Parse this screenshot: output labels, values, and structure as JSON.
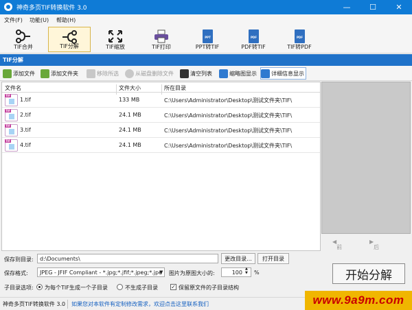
{
  "window": {
    "title": "神奇多页TIF转换软件 3.0",
    "controls": [
      "—",
      "☐",
      "✕"
    ]
  },
  "menu": [
    "文件(F)",
    "功能(U)",
    "帮助(H)"
  ],
  "toolbar": [
    "TIF合并",
    "TIF分解",
    "TIF缩放",
    "TIF打印",
    "PPT转TIF",
    "PDF转TIF",
    "TIF转PDF"
  ],
  "doc_badges": {
    "ppt": "PPT",
    "pdf": "PDF"
  },
  "section_title": "TIF分解",
  "actions": [
    "添加文件",
    "添加文件夹",
    "移除所选",
    "从磁盘删除文件",
    "清空列表",
    "缩略图显示",
    "详细信息显示"
  ],
  "columns": [
    "文件名",
    "文件大小",
    "所在目录"
  ],
  "files": [
    {
      "name": "1.tif",
      "size": "133 MB",
      "dir": "C:\\Users\\Administrator\\Desktop\\测试文件夹\\TIF\\"
    },
    {
      "name": "2.tif",
      "size": "24.1 MB",
      "dir": "C:\\Users\\Administrator\\Desktop\\测试文件夹\\TIF\\"
    },
    {
      "name": "3.tif",
      "size": "24.1 MB",
      "dir": "C:\\Users\\Administrator\\Desktop\\测试文件夹\\TIF\\"
    },
    {
      "name": "4.tif",
      "size": "24.1 MB",
      "dir": "C:\\Users\\Administrator\\Desktop\\测试文件夹\\TIF\\"
    }
  ],
  "pager": {
    "prev": "前一页",
    "next": "后一页"
  },
  "options": {
    "save_dir_label": "保存到目录:",
    "save_dir_value": "d:\\Documents\\",
    "change_dir_btn": "更改目录...",
    "open_dir_btn": "打开目录",
    "format_label": "保存格式:",
    "format_value": "JPEG - JFIF Compliant - *.jpg;*.jfif;*.jpeg;*.jpe",
    "scale_label": "图片为原图大小的:",
    "scale_value": "100",
    "scale_unit": "%",
    "subdir_label": "子目录选项:",
    "radio1": "为每个TIF生成一个子目录",
    "radio2": "不生成子目录",
    "checkbox": "保留原文件的子目录结构",
    "start_btn": "开始分解"
  },
  "status": {
    "app": "神奇多页TIF转换软件 3.0",
    "notice": "如果您对本软件有定制修改需求，欢迎点击这里联系我们"
  },
  "watermark": "www.9a9m.com"
}
